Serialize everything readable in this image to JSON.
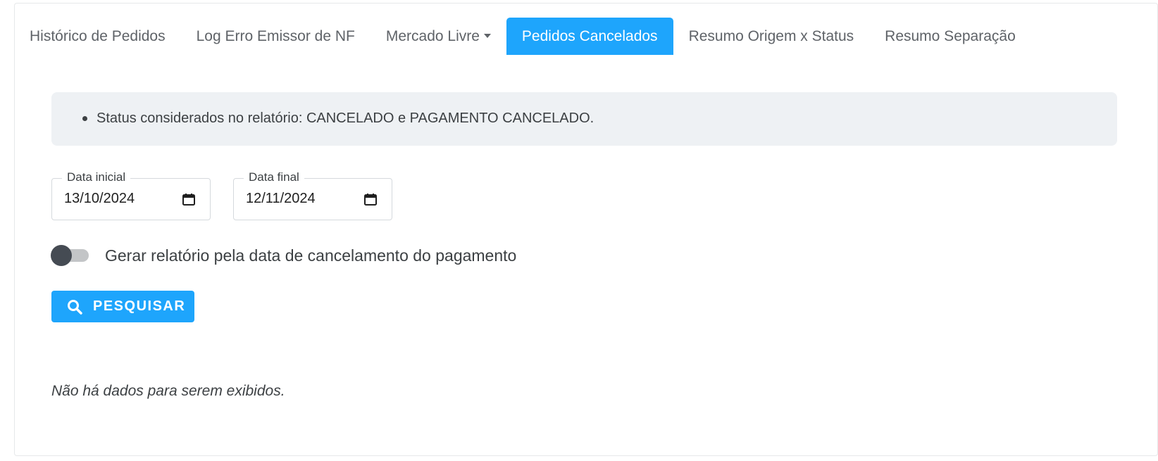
{
  "tabs": [
    {
      "label": "Histórico de Pedidos",
      "active": false
    },
    {
      "label": "Log Erro Emissor de NF",
      "active": false
    },
    {
      "label": "Mercado Livre",
      "active": false,
      "dropdown": true
    },
    {
      "label": "Pedidos Cancelados",
      "active": true
    },
    {
      "label": "Resumo Origem x Status",
      "active": false
    },
    {
      "label": "Resumo Separação",
      "active": false
    }
  ],
  "info": {
    "items": [
      "Status considerados no relatório: CANCELADO e PAGAMENTO CANCELADO."
    ]
  },
  "filters": {
    "start_date": {
      "label": "Data inicial",
      "value": "13/10/2024",
      "icon": "calendar-icon"
    },
    "end_date": {
      "label": "Data final",
      "value": "12/11/2024",
      "icon": "calendar-icon"
    }
  },
  "toggle": {
    "label": "Gerar relatório pela data de cancelamento do pagamento",
    "checked": false
  },
  "search_button": {
    "label": "PESQUISAR",
    "icon": "search-icon"
  },
  "empty_message": "Não há dados para serem exibidos.",
  "colors": {
    "accent": "#1ea5fc",
    "info_background": "#eef1f4",
    "toggle_knob": "#454b53",
    "text": "#3c4043"
  }
}
